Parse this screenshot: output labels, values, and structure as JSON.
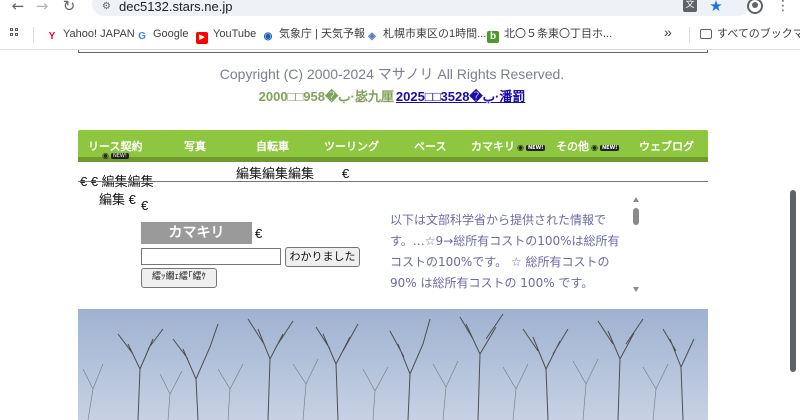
{
  "browser": {
    "url": "dec5132.stars.ne.jp",
    "site_info_icon": "tune-icon",
    "back_icon": "←",
    "forward_icon": "→",
    "reload_icon": "↻",
    "translate_icon": "文",
    "star_icon": "★",
    "menu_icon": "⋮",
    "more_icon": "»",
    "bookmarks": [
      {
        "label": "Yahoo! JAPAN",
        "icon": "Y",
        "color": "#ff0033"
      },
      {
        "label": "Google",
        "icon": "G",
        "color": "#4285f4"
      },
      {
        "label": "YouTube",
        "icon": "▶",
        "color": "#ff0000"
      },
      {
        "label": "気象庁 | 天気予報",
        "icon": "◉",
        "color": "#1d5fb8"
      },
      {
        "label": "札幌市東区の1時間...",
        "icon": "◈",
        "color": "#5a7fc2"
      },
      {
        "label": "北〇５条東〇丁目ホ...",
        "icon": "b",
        "color": "#4c9a2a"
      }
    ],
    "all_bookmarks_label": "すべてのブックマーク"
  },
  "page": {
    "copyright": "Copyright (C) 2000-2024 マサノリ All Rights Reserved.",
    "counter_green": "2000□□958�ب·毖九厘",
    "counter_link": "2025□□3528�ب·潘罰",
    "menu": [
      {
        "label": "リース契約"
      },
      {
        "label": "写真"
      },
      {
        "label": "自転車"
      },
      {
        "label": "ツーリング"
      },
      {
        "label": "ベース"
      },
      {
        "label": "カマキリ"
      },
      {
        "label": "その他"
      },
      {
        "label": "ウェブログ"
      }
    ],
    "new_badge": "NEW!",
    "eye_icon": "👁",
    "edit_line1": "€ € 編集編集",
    "edit_line1b": "編集編集編集",
    "euro": "€",
    "edit_line2": "編集 €",
    "kamakiri_label": "カマキリ",
    "input_value": "",
    "ok_button": "わかりました",
    "garbled_button": "繧ｯ繝ｪ繧｢繧ｹ",
    "info_text": "以下は文部科学省から提供された情報です。…☆9→総所有コストの100%は総所有コストの100%です。 ☆ 総所有コストの 90% は総所有コストの 100% です。"
  }
}
